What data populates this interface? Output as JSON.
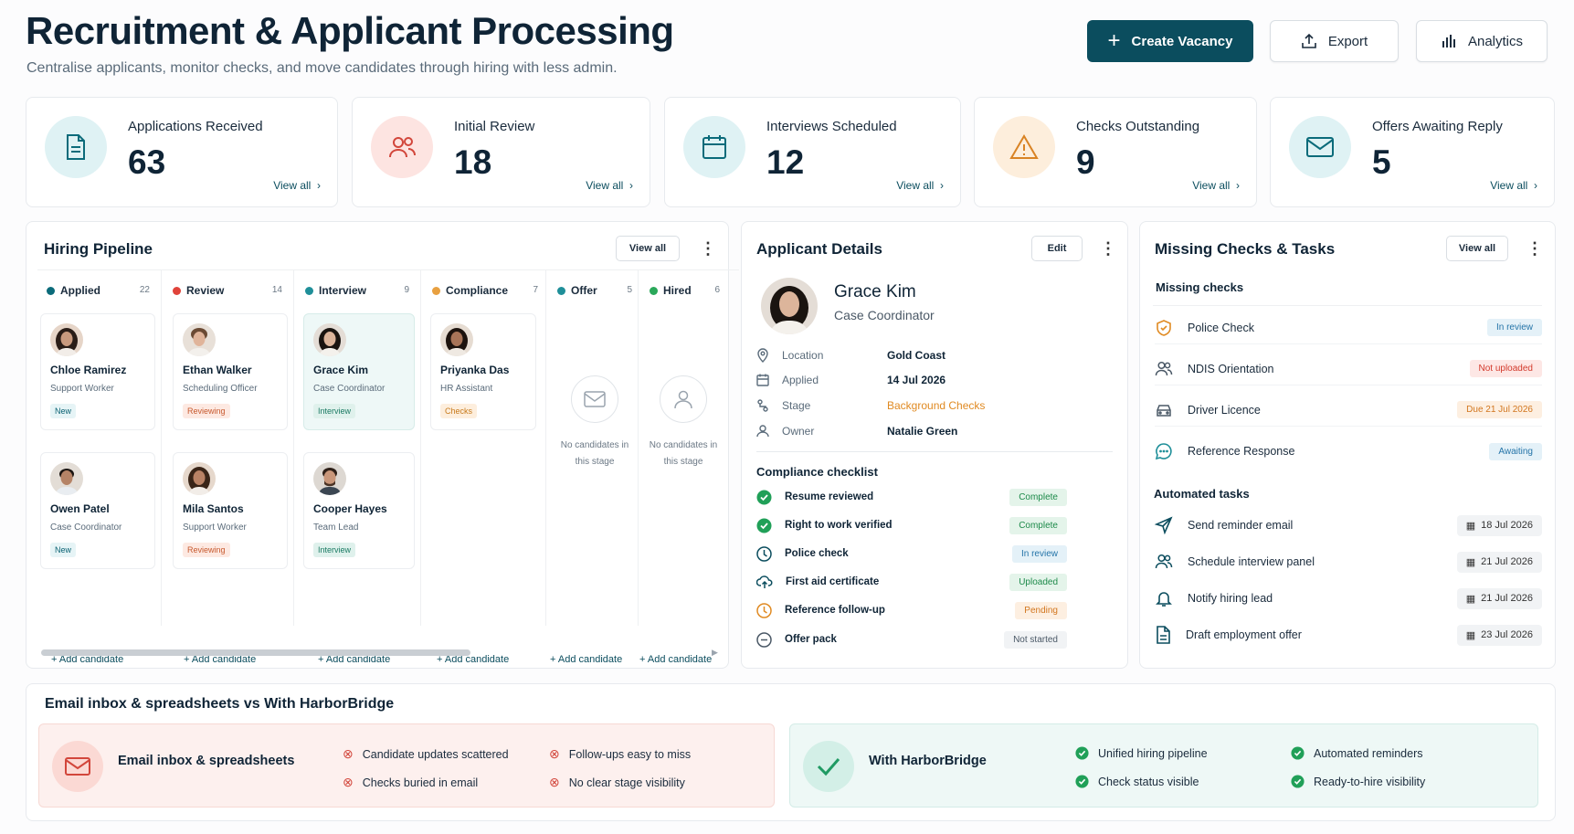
{
  "header": {
    "title": "Recruitment & Applicant Processing",
    "subtitle": "Centralise applicants, monitor checks, and move candidates through hiring with less admin.",
    "buttons": {
      "create": "Create Vacancy",
      "export": "Export",
      "analytics": "Analytics"
    }
  },
  "stats": [
    {
      "label": "Applications Received",
      "value": "63",
      "link": "View all",
      "icon": "document-icon",
      "color": "#0b6b7a"
    },
    {
      "label": "Initial Review",
      "value": "18",
      "link": "View all",
      "icon": "users-icon",
      "color": "#d2463b"
    },
    {
      "label": "Interviews Scheduled",
      "value": "12",
      "link": "View all",
      "icon": "calendar-icon",
      "color": "#0b6b7a"
    },
    {
      "label": "Checks Outstanding",
      "value": "9",
      "link": "View all",
      "icon": "warning-icon",
      "color": "#d98324"
    },
    {
      "label": "Offers Awaiting Reply",
      "value": "5",
      "link": "View all",
      "icon": "mail-icon",
      "color": "#0b6b7a"
    }
  ],
  "pipeline": {
    "title": "Hiring Pipeline",
    "view_all": "View all",
    "add_label": "+ Add candidate",
    "empty_text": "No candidates in this stage",
    "columns": [
      {
        "name": "Applied",
        "count": "22",
        "color": "#0b6b7a"
      },
      {
        "name": "Review",
        "count": "14",
        "color": "#e0433a"
      },
      {
        "name": "Interview",
        "count": "9",
        "color": "#1f8f99"
      },
      {
        "name": "Compliance",
        "count": "7",
        "color": "#e8a040"
      },
      {
        "name": "Offer",
        "count": "5",
        "color": "#1f8f99"
      },
      {
        "name": "Hired",
        "count": "6",
        "color": "#2aa85a"
      }
    ],
    "candidates": [
      {
        "name": "Chloe Ramirez",
        "role": "Support Worker",
        "badge": "New"
      },
      {
        "name": "Owen Patel",
        "role": "Case Coordinator",
        "badge": "New"
      },
      {
        "name": "Ethan Walker",
        "role": "Scheduling Officer",
        "badge": "Reviewing"
      },
      {
        "name": "Mila Santos",
        "role": "Support Worker",
        "badge": "Reviewing"
      },
      {
        "name": "Grace Kim",
        "role": "Case Coordinator",
        "badge": "Interview"
      },
      {
        "name": "Cooper Hayes",
        "role": "Team Lead",
        "badge": "Interview"
      },
      {
        "name": "Priyanka Das",
        "role": "HR Assistant",
        "badge": "Checks"
      }
    ]
  },
  "applicant": {
    "title": "Applicant Details",
    "edit": "Edit",
    "name": "Grace Kim",
    "role": "Case Coordinator",
    "fields": [
      {
        "key": "Location",
        "value": "Gold Coast",
        "icon": "location-pin-icon"
      },
      {
        "key": "Applied",
        "value": "14 Jul 2026",
        "icon": "calendar-icon"
      },
      {
        "key": "Stage",
        "value": "Background Checks",
        "icon": "stage-icon"
      },
      {
        "key": "Owner",
        "value": "Natalie Green",
        "icon": "person-icon"
      }
    ],
    "checklist_title": "Compliance checklist",
    "checklist": [
      {
        "label": "Resume reviewed",
        "status": "Complete",
        "icon": "check-circle-icon"
      },
      {
        "label": "Right to work verified",
        "status": "Complete",
        "icon": "check-circle-icon"
      },
      {
        "label": "Police check",
        "status": "In review",
        "icon": "clock-icon"
      },
      {
        "label": "First aid certificate",
        "status": "Uploaded",
        "icon": "cloud-upload-icon"
      },
      {
        "label": "Reference follow-up",
        "status": "Pending",
        "icon": "clock-icon"
      },
      {
        "label": "Offer pack",
        "status": "Not started",
        "icon": "minus-circle-icon"
      }
    ]
  },
  "missing": {
    "title": "Missing Checks & Tasks",
    "view_all": "View all",
    "checks_title": "Missing checks",
    "checks": [
      {
        "label": "Police Check",
        "status": "In review",
        "icon": "shield-icon"
      },
      {
        "label": "NDIS Orientation",
        "status": "Not uploaded",
        "icon": "users-icon"
      },
      {
        "label": "Driver Licence",
        "status": "Due 21 Jul 2026",
        "icon": "car-icon"
      },
      {
        "label": "Reference Response",
        "status": "Awaiting",
        "icon": "chat-icon"
      }
    ],
    "tasks_title": "Automated tasks",
    "tasks": [
      {
        "label": "Send reminder email",
        "date": "18 Jul 2026",
        "icon": "send-icon"
      },
      {
        "label": "Schedule interview panel",
        "date": "21 Jul 2026",
        "icon": "users-icon"
      },
      {
        "label": "Notify hiring lead",
        "date": "21 Jul 2026",
        "icon": "bell-icon"
      },
      {
        "label": "Draft employment offer",
        "date": "23 Jul 2026",
        "icon": "document-icon"
      }
    ]
  },
  "compare": {
    "title": "Email inbox & spreadsheets vs With HarborBridge",
    "left": {
      "heading": "Email inbox & spreadsheets",
      "items": [
        "Candidate updates scattered",
        "Follow-ups easy to miss",
        "Checks buried in email",
        "No clear stage visibility"
      ]
    },
    "right": {
      "heading": "With HarborBridge",
      "items": [
        "Unified hiring pipeline",
        "Automated reminders",
        "Check status visible",
        "Ready-to-hire visibility"
      ]
    }
  }
}
